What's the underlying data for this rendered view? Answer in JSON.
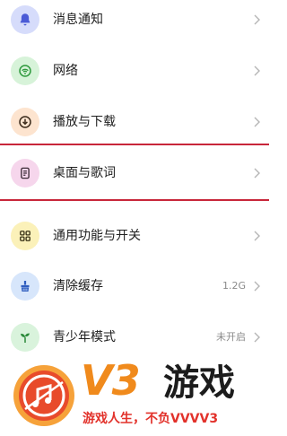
{
  "settings": {
    "items": [
      {
        "label": "消息通知",
        "value": "",
        "icon": "bell-icon",
        "icon_bg": "#d6dcfb",
        "icon_fg": "#4b5bd6"
      },
      {
        "label": "网络",
        "value": "",
        "icon": "wifi-icon",
        "icon_bg": "#d7f3d9",
        "icon_fg": "#2f9a3e"
      },
      {
        "label": "播放与下载",
        "value": "",
        "icon": "download-icon",
        "icon_bg": "#fde4cf",
        "icon_fg": "#3a2a1a"
      },
      {
        "label": "桌面与歌词",
        "value": "",
        "icon": "lyrics-icon",
        "icon_bg": "#f6d6ec",
        "icon_fg": "#3a2a35"
      },
      {
        "label": "通用功能与开关",
        "value": "",
        "icon": "grid-icon",
        "icon_bg": "#fbf1b9",
        "icon_fg": "#3a3318"
      },
      {
        "label": "清除缓存",
        "value": "1.2G",
        "icon": "broom-icon",
        "icon_bg": "#d7e6fb",
        "icon_fg": "#2e5dbf"
      },
      {
        "label": "青少年模式",
        "value": "未开启",
        "icon": "sprout-icon",
        "icon_bg": "#d9f3dc",
        "icon_fg": "#2b8a3a"
      }
    ]
  },
  "watermark": {
    "brand": "V3",
    "game": "游戏",
    "slogan": "游戏人生，不负VVVV3"
  },
  "colors": {
    "highlight_line": "#c8263a",
    "chevron": "#b5b5b5"
  }
}
